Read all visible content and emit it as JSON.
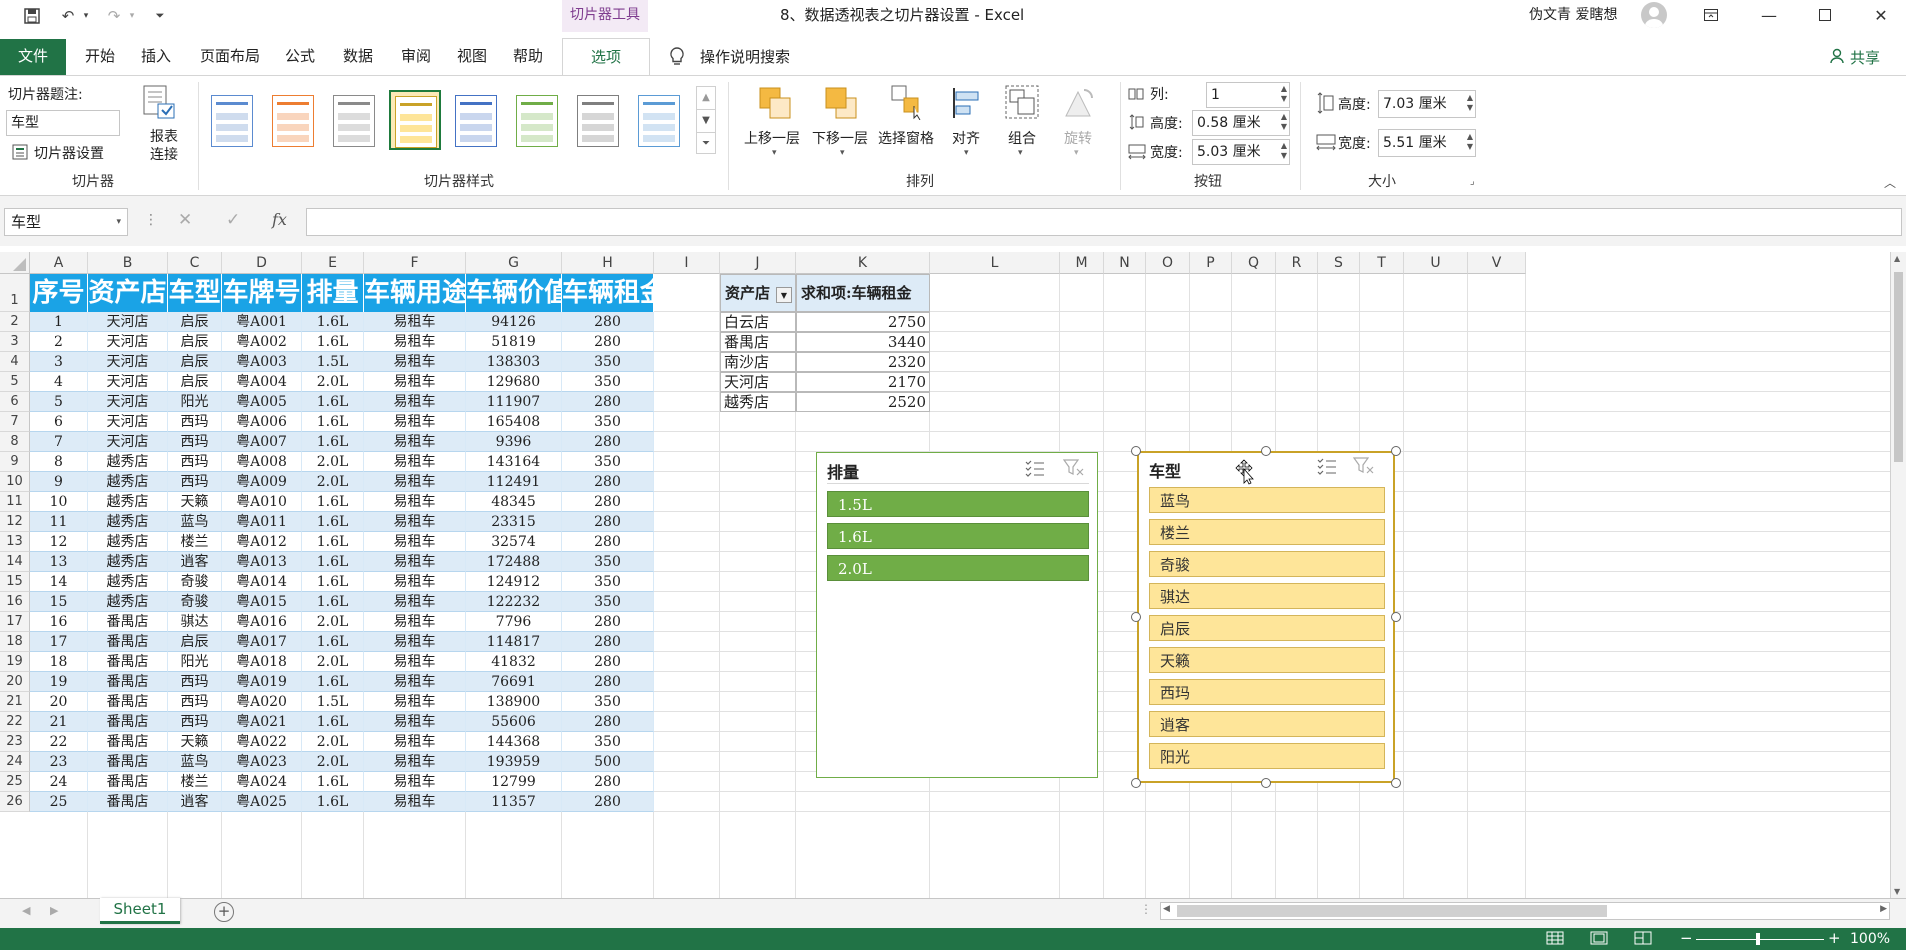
{
  "title_bar": {
    "context_tab_label": "切片器工具",
    "document_title": "8、数据透视表之切片器设置  -  Excel",
    "user_name": "伪文青 爱瞎想"
  },
  "tabs": [
    "文件",
    "开始",
    "插入",
    "页面布局",
    "公式",
    "数据",
    "审阅",
    "视图",
    "帮助",
    "选项"
  ],
  "tell_me": "操作说明搜索",
  "share": "共享",
  "ribbon": {
    "slicer_group": {
      "caption_label": "切片器题注:",
      "caption_value": "车型",
      "settings_button": "切片器设置",
      "report_connections_button": "报表\n连接",
      "group_label": "切片器"
    },
    "styles_group": {
      "group_label": "切片器样式"
    },
    "arrange_group": {
      "bring_forward": "上移一层",
      "send_backward": "下移一层",
      "selection_pane": "选择窗格",
      "align": "对齐",
      "group": "组合",
      "rotate": "旋转",
      "group_label": "排列"
    },
    "buttons_group": {
      "columns_label": "列:",
      "columns_value": "1",
      "height_label": "高度:",
      "height_value": "0.58 厘米",
      "width_label": "宽度:",
      "width_value": "5.03 厘米",
      "group_label": "按钮"
    },
    "size_group": {
      "height_label": "高度:",
      "height_value": "7.03 厘米",
      "width_label": "宽度:",
      "width_value": "5.51 厘米",
      "group_label": "大小"
    }
  },
  "formula_bar": {
    "name_box": "车型",
    "fx": "fx",
    "formula": ""
  },
  "columns": [
    "A",
    "B",
    "C",
    "D",
    "E",
    "F",
    "G",
    "H",
    "I",
    "J",
    "K",
    "L",
    "M",
    "N",
    "O",
    "P",
    "Q",
    "R",
    "S",
    "T",
    "U",
    "V"
  ],
  "rows": [
    "1",
    "2",
    "3",
    "4",
    "5",
    "6",
    "7",
    "8",
    "9",
    "10",
    "11",
    "12",
    "13",
    "14",
    "15",
    "16",
    "17",
    "18",
    "19",
    "20",
    "21",
    "22",
    "23",
    "24",
    "25",
    "26"
  ],
  "table": {
    "headers": [
      "序号",
      "资产店",
      "车型",
      "车牌号",
      "排量",
      "车辆用途",
      "车辆价值",
      "车辆租金"
    ],
    "rows": [
      [
        "1",
        "天河店",
        "启辰",
        "粤A001",
        "1.6L",
        "易租车",
        "94126",
        "280"
      ],
      [
        "2",
        "天河店",
        "启辰",
        "粤A002",
        "1.6L",
        "易租车",
        "51819",
        "280"
      ],
      [
        "3",
        "天河店",
        "启辰",
        "粤A003",
        "1.5L",
        "易租车",
        "138303",
        "350"
      ],
      [
        "4",
        "天河店",
        "启辰",
        "粤A004",
        "2.0L",
        "易租车",
        "129680",
        "350"
      ],
      [
        "5",
        "天河店",
        "阳光",
        "粤A005",
        "1.6L",
        "易租车",
        "111907",
        "280"
      ],
      [
        "6",
        "天河店",
        "西玛",
        "粤A006",
        "1.6L",
        "易租车",
        "165408",
        "350"
      ],
      [
        "7",
        "天河店",
        "西玛",
        "粤A007",
        "1.6L",
        "易租车",
        "9396",
        "280"
      ],
      [
        "8",
        "越秀店",
        "西玛",
        "粤A008",
        "2.0L",
        "易租车",
        "143164",
        "350"
      ],
      [
        "9",
        "越秀店",
        "西玛",
        "粤A009",
        "2.0L",
        "易租车",
        "112491",
        "280"
      ],
      [
        "10",
        "越秀店",
        "天籁",
        "粤A010",
        "1.6L",
        "易租车",
        "48345",
        "280"
      ],
      [
        "11",
        "越秀店",
        "蓝鸟",
        "粤A011",
        "1.6L",
        "易租车",
        "23315",
        "280"
      ],
      [
        "12",
        "越秀店",
        "楼兰",
        "粤A012",
        "1.6L",
        "易租车",
        "32574",
        "280"
      ],
      [
        "13",
        "越秀店",
        "逍客",
        "粤A013",
        "1.6L",
        "易租车",
        "172488",
        "350"
      ],
      [
        "14",
        "越秀店",
        "奇骏",
        "粤A014",
        "1.6L",
        "易租车",
        "124912",
        "350"
      ],
      [
        "15",
        "越秀店",
        "奇骏",
        "粤A015",
        "1.6L",
        "易租车",
        "122232",
        "350"
      ],
      [
        "16",
        "番禺店",
        "骐达",
        "粤A016",
        "2.0L",
        "易租车",
        "7796",
        "280"
      ],
      [
        "17",
        "番禺店",
        "启辰",
        "粤A017",
        "1.6L",
        "易租车",
        "114817",
        "280"
      ],
      [
        "18",
        "番禺店",
        "阳光",
        "粤A018",
        "2.0L",
        "易租车",
        "41832",
        "280"
      ],
      [
        "19",
        "番禺店",
        "西玛",
        "粤A019",
        "1.6L",
        "易租车",
        "76691",
        "280"
      ],
      [
        "20",
        "番禺店",
        "西玛",
        "粤A020",
        "1.5L",
        "易租车",
        "138900",
        "350"
      ],
      [
        "21",
        "番禺店",
        "西玛",
        "粤A021",
        "1.6L",
        "易租车",
        "55606",
        "280"
      ],
      [
        "22",
        "番禺店",
        "天籁",
        "粤A022",
        "2.0L",
        "易租车",
        "144368",
        "350"
      ],
      [
        "23",
        "番禺店",
        "蓝鸟",
        "粤A023",
        "2.0L",
        "易租车",
        "193959",
        "500"
      ],
      [
        "24",
        "番禺店",
        "楼兰",
        "粤A024",
        "1.6L",
        "易租车",
        "12799",
        "280"
      ],
      [
        "25",
        "番禺店",
        "逍客",
        "粤A025",
        "1.6L",
        "易租车",
        "11357",
        "280"
      ]
    ]
  },
  "pivot": {
    "header_field": "资产店",
    "header_value": "求和项:车辆租金",
    "rows": [
      {
        "store": "白云店",
        "sum": "2750"
      },
      {
        "store": "番禺店",
        "sum": "3440"
      },
      {
        "store": "南沙店",
        "sum": "2320"
      },
      {
        "store": "天河店",
        "sum": "2170"
      },
      {
        "store": "越秀店",
        "sum": "2520"
      }
    ]
  },
  "slicers": {
    "displacement": {
      "title": "排量",
      "items": [
        "1.5L",
        "1.6L",
        "2.0L"
      ]
    },
    "model": {
      "title": "车型",
      "items": [
        "蓝鸟",
        "楼兰",
        "奇骏",
        "骐达",
        "启辰",
        "天籁",
        "西玛",
        "逍客",
        "阳光"
      ]
    }
  },
  "sheet_tab": "Sheet1",
  "status": {
    "zoom": "100%"
  },
  "colors": {
    "excel_green": "#217346",
    "table_header": "#1aa3e6",
    "band_blue": "#ddebf7",
    "slicer_green": "#70ad47",
    "slicer_yellow": "#fee599"
  }
}
